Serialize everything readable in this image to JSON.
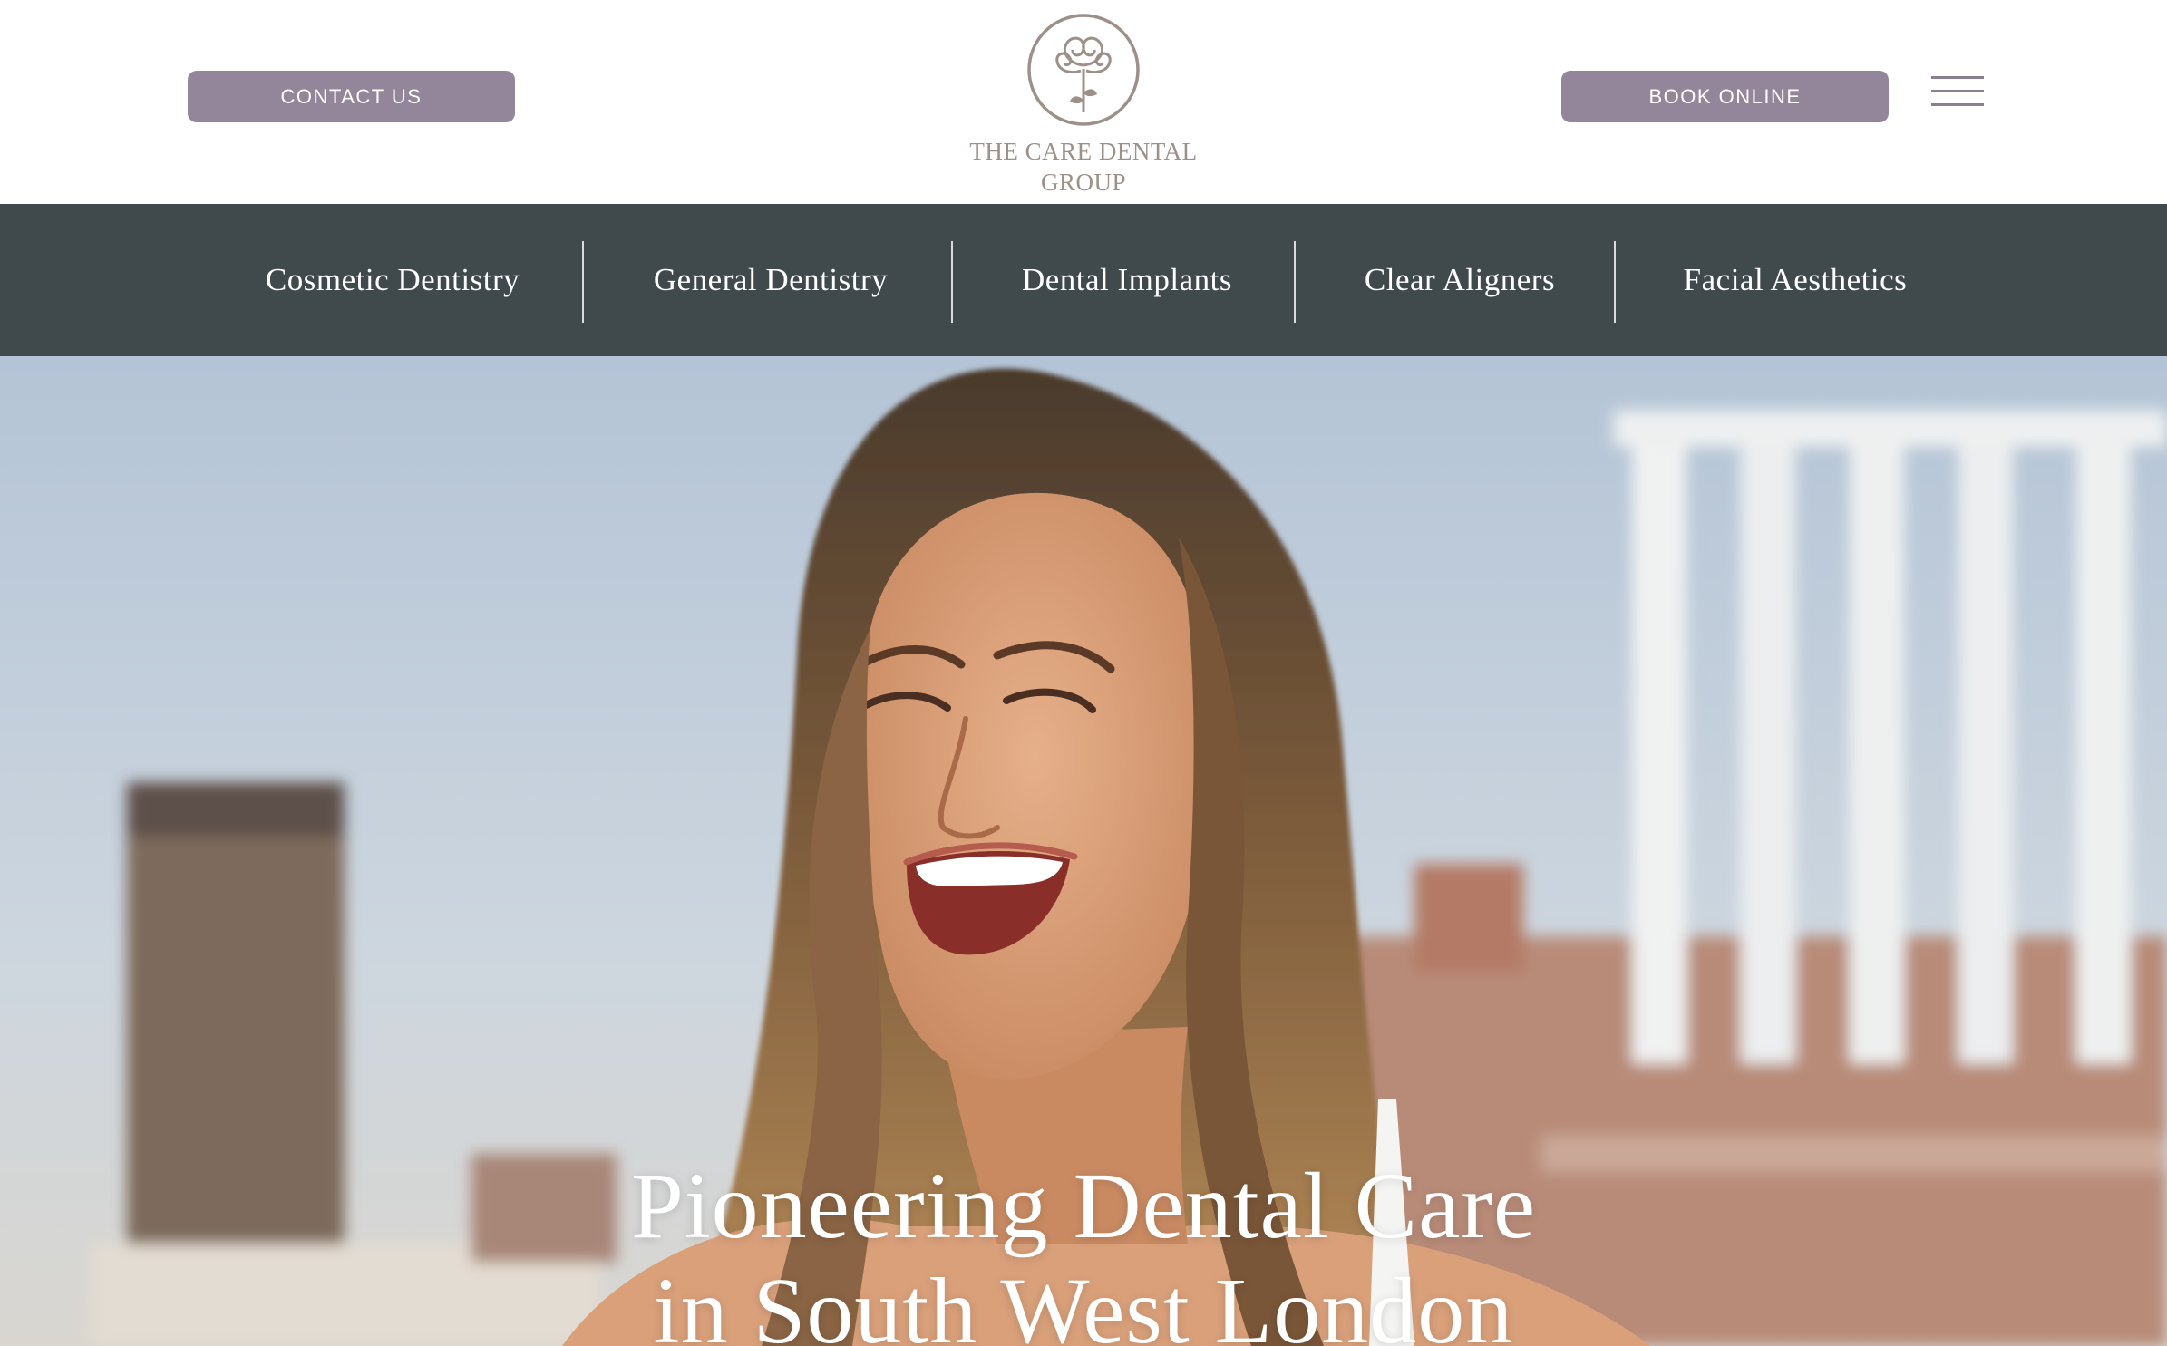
{
  "header": {
    "contact_label": "CONTACT US",
    "book_label": "BOOK ONLINE",
    "logo_line1": "THE CARE DENTAL",
    "logo_line2": "GROUP",
    "menu_icon": "hamburger-menu-icon"
  },
  "nav": {
    "items": [
      {
        "label": "Cosmetic Dentistry"
      },
      {
        "label": "General Dentistry"
      },
      {
        "label": "Dental Implants"
      },
      {
        "label": "Clear Aligners"
      },
      {
        "label": "Facial Aesthetics"
      }
    ]
  },
  "hero": {
    "heading_line1": "Pioneering Dental Care",
    "heading_line2": "in South West London"
  },
  "colors": {
    "button": "#94869a",
    "nav_background": "#404a4d",
    "logo": "#9c9088",
    "white": "#ffffff"
  }
}
